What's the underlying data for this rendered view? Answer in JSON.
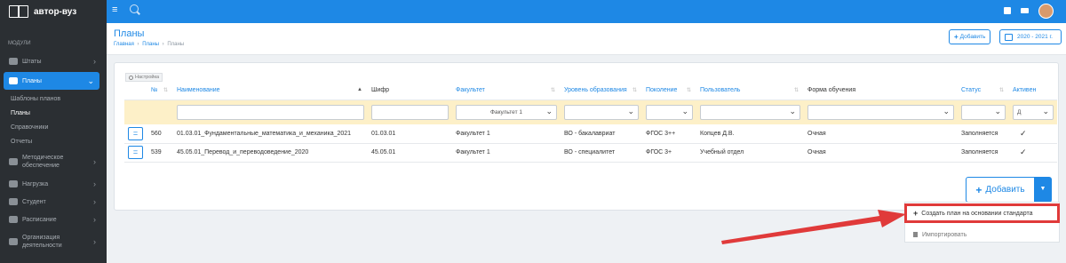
{
  "app": {
    "logo_text": "автор-вуз"
  },
  "sidebar": {
    "section_label": "МОДУЛИ",
    "items": [
      {
        "label": "Штаты",
        "icon": "users-icon"
      },
      {
        "label": "Планы",
        "icon": "book-icon",
        "active": true
      },
      {
        "label": "Методическое обеспечение",
        "icon": "folder-icon"
      },
      {
        "label": "Нагрузка",
        "icon": "briefcase-icon"
      },
      {
        "label": "Студент",
        "icon": "users-icon"
      },
      {
        "label": "Расписание",
        "icon": "calendar-icon"
      },
      {
        "label": "Организация деятельности",
        "icon": "sitemap-icon"
      }
    ],
    "sub_items": [
      "Шаблоны планов",
      "Планы",
      "Справочники",
      "Отчеты"
    ],
    "method_line1": "Методическое",
    "method_line2": "обеспечение",
    "org_line1": "Организация",
    "org_line2": "деятельности"
  },
  "header": {
    "title": "Планы",
    "breadcrumbs": [
      "Главная",
      "Планы",
      "Планы"
    ],
    "add_label": "Добавить",
    "year_label": "2020 - 2021 г."
  },
  "table": {
    "settings_label": "Настройка",
    "columns": [
      "№",
      "Наименование",
      "Шифр",
      "Факультет",
      "Уровень образования",
      "Поколение",
      "Пользователь",
      "Форма обучения",
      "Статус",
      "Активен"
    ],
    "filter_faculty": "Факультет 1",
    "filter_active": "Д",
    "rows": [
      {
        "num": "560",
        "name": "01.03.01_Фундаментальные_математика_и_механика_2021",
        "code": "01.03.01",
        "faculty": "Факультет 1",
        "level": "ВО - бакалавриат",
        "generation": "ФГОС 3++",
        "user": "Копцев Д.В.",
        "form": "Очная",
        "status": "Заполняется",
        "active": "✓"
      },
      {
        "num": "539",
        "name": "45.05.01_Перевод_и_переводоведение_2020",
        "code": "45.05.01",
        "faculty": "Факультет 1",
        "level": "ВО - специалитет",
        "generation": "ФГОС 3+",
        "user": "Учебный отдел",
        "form": "Очная",
        "status": "Заполняется",
        "active": "✓"
      }
    ],
    "add_button": "Добавить"
  },
  "dropdown": {
    "create_from_standard": "Создать план на основании стандарта",
    "import": "Импортировать"
  },
  "colors": {
    "accent": "#1e88e5",
    "sidebar": "#2b2f33",
    "filter_row": "#fdf0c8",
    "annotation": "#e03a3a"
  }
}
